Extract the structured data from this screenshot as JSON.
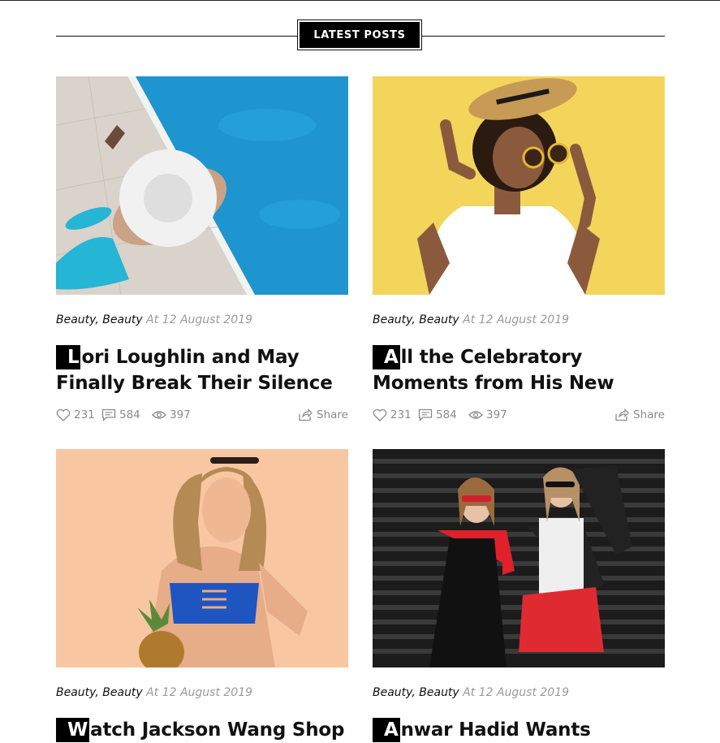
{
  "section": {
    "title": "LATEST POSTS"
  },
  "posts": [
    {
      "cat1": "Beauty",
      "sep": ",",
      "cat2": "Beauty",
      "date": "At 12 August 2019",
      "dropcap": "L",
      "title_rest": "ori Loughlin and May Finally Break Their Silence",
      "likes": "231",
      "comments": "584",
      "views": "397",
      "share": "Share"
    },
    {
      "cat1": "Beauty",
      "sep": ",",
      "cat2": "Beauty",
      "date": "At 12 August 2019",
      "dropcap": "A",
      "title_rest": "ll the Celebratory Moments from His New",
      "likes": "231",
      "comments": "584",
      "views": "397",
      "share": "Share"
    },
    {
      "cat1": "Beauty",
      "sep": ",",
      "cat2": "Beauty",
      "date": "At 12 August 2019",
      "dropcap": "W",
      "title_rest": "atch Jackson Wang Shop",
      "likes": "",
      "comments": "",
      "views": "",
      "share": ""
    },
    {
      "cat1": "Beauty",
      "sep": ",",
      "cat2": "Beauty",
      "date": "At 12 August 2019",
      "dropcap": "A",
      "title_rest": "nwar Hadid Wants",
      "likes": "",
      "comments": "",
      "views": "",
      "share": ""
    }
  ],
  "colors": {
    "accent": "#000000",
    "muted": "#8a8a8a",
    "date": "#9a9a9a"
  }
}
